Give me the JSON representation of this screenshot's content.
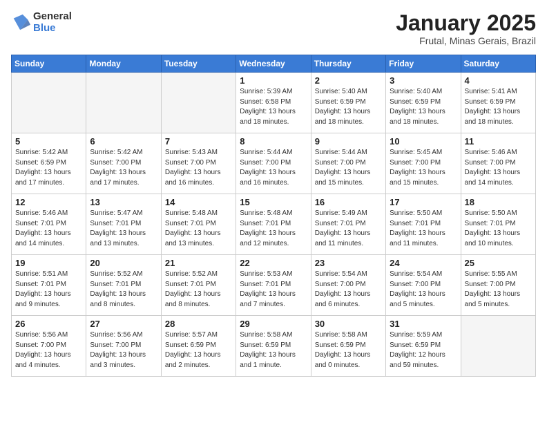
{
  "header": {
    "logo_text_top": "General",
    "logo_text_bottom": "Blue",
    "month_title": "January 2025",
    "location": "Frutal, Minas Gerais, Brazil"
  },
  "weekdays": [
    "Sunday",
    "Monday",
    "Tuesday",
    "Wednesday",
    "Thursday",
    "Friday",
    "Saturday"
  ],
  "weeks": [
    [
      {
        "day": "",
        "info": ""
      },
      {
        "day": "",
        "info": ""
      },
      {
        "day": "",
        "info": ""
      },
      {
        "day": "1",
        "info": "Sunrise: 5:39 AM\nSunset: 6:58 PM\nDaylight: 13 hours\nand 18 minutes."
      },
      {
        "day": "2",
        "info": "Sunrise: 5:40 AM\nSunset: 6:59 PM\nDaylight: 13 hours\nand 18 minutes."
      },
      {
        "day": "3",
        "info": "Sunrise: 5:40 AM\nSunset: 6:59 PM\nDaylight: 13 hours\nand 18 minutes."
      },
      {
        "day": "4",
        "info": "Sunrise: 5:41 AM\nSunset: 6:59 PM\nDaylight: 13 hours\nand 18 minutes."
      }
    ],
    [
      {
        "day": "5",
        "info": "Sunrise: 5:42 AM\nSunset: 6:59 PM\nDaylight: 13 hours\nand 17 minutes."
      },
      {
        "day": "6",
        "info": "Sunrise: 5:42 AM\nSunset: 7:00 PM\nDaylight: 13 hours\nand 17 minutes."
      },
      {
        "day": "7",
        "info": "Sunrise: 5:43 AM\nSunset: 7:00 PM\nDaylight: 13 hours\nand 16 minutes."
      },
      {
        "day": "8",
        "info": "Sunrise: 5:44 AM\nSunset: 7:00 PM\nDaylight: 13 hours\nand 16 minutes."
      },
      {
        "day": "9",
        "info": "Sunrise: 5:44 AM\nSunset: 7:00 PM\nDaylight: 13 hours\nand 15 minutes."
      },
      {
        "day": "10",
        "info": "Sunrise: 5:45 AM\nSunset: 7:00 PM\nDaylight: 13 hours\nand 15 minutes."
      },
      {
        "day": "11",
        "info": "Sunrise: 5:46 AM\nSunset: 7:00 PM\nDaylight: 13 hours\nand 14 minutes."
      }
    ],
    [
      {
        "day": "12",
        "info": "Sunrise: 5:46 AM\nSunset: 7:01 PM\nDaylight: 13 hours\nand 14 minutes."
      },
      {
        "day": "13",
        "info": "Sunrise: 5:47 AM\nSunset: 7:01 PM\nDaylight: 13 hours\nand 13 minutes."
      },
      {
        "day": "14",
        "info": "Sunrise: 5:48 AM\nSunset: 7:01 PM\nDaylight: 13 hours\nand 13 minutes."
      },
      {
        "day": "15",
        "info": "Sunrise: 5:48 AM\nSunset: 7:01 PM\nDaylight: 13 hours\nand 12 minutes."
      },
      {
        "day": "16",
        "info": "Sunrise: 5:49 AM\nSunset: 7:01 PM\nDaylight: 13 hours\nand 11 minutes."
      },
      {
        "day": "17",
        "info": "Sunrise: 5:50 AM\nSunset: 7:01 PM\nDaylight: 13 hours\nand 11 minutes."
      },
      {
        "day": "18",
        "info": "Sunrise: 5:50 AM\nSunset: 7:01 PM\nDaylight: 13 hours\nand 10 minutes."
      }
    ],
    [
      {
        "day": "19",
        "info": "Sunrise: 5:51 AM\nSunset: 7:01 PM\nDaylight: 13 hours\nand 9 minutes."
      },
      {
        "day": "20",
        "info": "Sunrise: 5:52 AM\nSunset: 7:01 PM\nDaylight: 13 hours\nand 8 minutes."
      },
      {
        "day": "21",
        "info": "Sunrise: 5:52 AM\nSunset: 7:01 PM\nDaylight: 13 hours\nand 8 minutes."
      },
      {
        "day": "22",
        "info": "Sunrise: 5:53 AM\nSunset: 7:01 PM\nDaylight: 13 hours\nand 7 minutes."
      },
      {
        "day": "23",
        "info": "Sunrise: 5:54 AM\nSunset: 7:00 PM\nDaylight: 13 hours\nand 6 minutes."
      },
      {
        "day": "24",
        "info": "Sunrise: 5:54 AM\nSunset: 7:00 PM\nDaylight: 13 hours\nand 5 minutes."
      },
      {
        "day": "25",
        "info": "Sunrise: 5:55 AM\nSunset: 7:00 PM\nDaylight: 13 hours\nand 5 minutes."
      }
    ],
    [
      {
        "day": "26",
        "info": "Sunrise: 5:56 AM\nSunset: 7:00 PM\nDaylight: 13 hours\nand 4 minutes."
      },
      {
        "day": "27",
        "info": "Sunrise: 5:56 AM\nSunset: 7:00 PM\nDaylight: 13 hours\nand 3 minutes."
      },
      {
        "day": "28",
        "info": "Sunrise: 5:57 AM\nSunset: 6:59 PM\nDaylight: 13 hours\nand 2 minutes."
      },
      {
        "day": "29",
        "info": "Sunrise: 5:58 AM\nSunset: 6:59 PM\nDaylight: 13 hours\nand 1 minute."
      },
      {
        "day": "30",
        "info": "Sunrise: 5:58 AM\nSunset: 6:59 PM\nDaylight: 13 hours\nand 0 minutes."
      },
      {
        "day": "31",
        "info": "Sunrise: 5:59 AM\nSunset: 6:59 PM\nDaylight: 12 hours\nand 59 minutes."
      },
      {
        "day": "",
        "info": ""
      }
    ]
  ]
}
